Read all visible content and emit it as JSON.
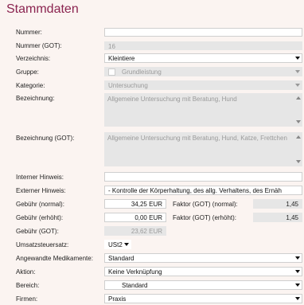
{
  "title": "Stammdaten",
  "labels": {
    "nummer": "Nummer:",
    "nummer_got": "Nummer (GOT):",
    "verzeichnis": "Verzeichnis:",
    "gruppe": "Gruppe:",
    "kategorie": "Kategorie:",
    "bezeichnung": "Bezeichnung:",
    "bezeichnung_got": "Bezeichnung (GOT):",
    "interner_hinweis": "Interner Hinweis:",
    "externer_hinweis": "Externer Hinweis:",
    "gebuehr_normal": "Gebühr (normal):",
    "gebuehr_erhoeht": "Gebühr (erhöht):",
    "gebuehr_got": "Gebühr (GOT):",
    "umsatzsteuersatz": "Umsatzsteuersatz:",
    "medikamente": "Angewandte Medikamente:",
    "aktion": "Aktion:",
    "bereich": "Bereich:",
    "firmen": "Firmen:",
    "faktor_normal": "Faktor (GOT) (normal):",
    "faktor_erhoeht": "Faktor (GOT) (erhöht):"
  },
  "values": {
    "nummer": "",
    "nummer_got": "16",
    "verzeichnis": "Kleintiere",
    "gruppe": "Grundleistung",
    "kategorie": "Untersuchung",
    "bezeichnung": "Allgemeine Untersuchung mit Beratung, Hund",
    "bezeichnung_got": "Allgemeine Untersuchung mit Beratung, Hund, Katze, Frettchen",
    "interner_hinweis": "",
    "externer_hinweis": "- Kontrolle der Körperhaltung, des allg. Verhaltens, des Ernäh",
    "gebuehr_normal": "34,25 EUR",
    "gebuehr_erhoeht": "0,00 EUR",
    "gebuehr_got": "23,62 EUR",
    "faktor_normal": "1,45",
    "faktor_erhoeht": "1,45",
    "umsatzsteuersatz": "USt2",
    "medikamente": "Standard",
    "aktion": "Keine Verknüpfung",
    "bereich": "Standard",
    "firmen": "Praxis"
  },
  "colors": {
    "title": "#8b2450",
    "panel_bg": "#fbf4f1",
    "readonly_bg": "#e6e6e6"
  }
}
